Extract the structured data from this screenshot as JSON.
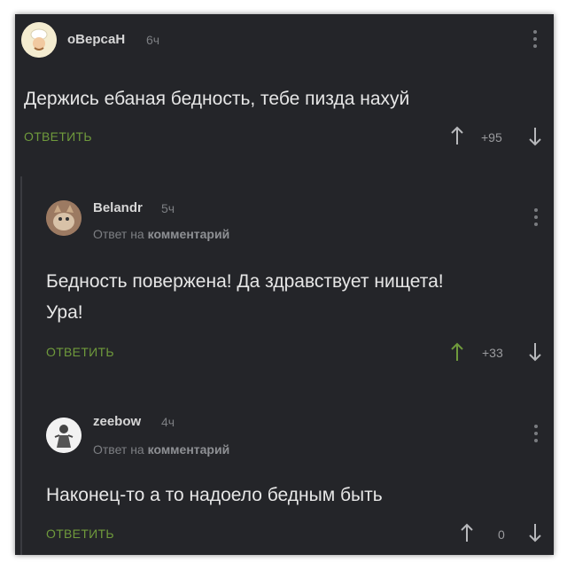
{
  "comments": [
    {
      "username": "оВерсаН",
      "time": "6ч",
      "reply_to": "",
      "reply_bold": "",
      "text": "Держись ебаная бедность, тебе пизда нахуй",
      "answer_label": "ОТВЕТИТЬ",
      "rating": "+95",
      "upvoted": false
    },
    {
      "username": "Belandr",
      "time": "5ч",
      "reply_to": "Ответ на",
      "reply_bold": "комментарий",
      "text": "Бедность повержена! Да здравствует нищета! Ура!",
      "answer_label": "ОТВЕТИТЬ",
      "rating": "+33",
      "upvoted": true
    },
    {
      "username": "zeebow",
      "time": "4ч",
      "reply_to": "Ответ на",
      "reply_bold": "комментарий",
      "text": "Наконец-то а то надоело бедным быть",
      "answer_label": "ОТВЕТИТЬ",
      "rating": "0",
      "upvoted": false
    }
  ],
  "colors": {
    "background": "#242529",
    "answer_green": "#6f9a3c",
    "upvote_active": "#6f9a3c",
    "muted": "#7d7f83"
  }
}
